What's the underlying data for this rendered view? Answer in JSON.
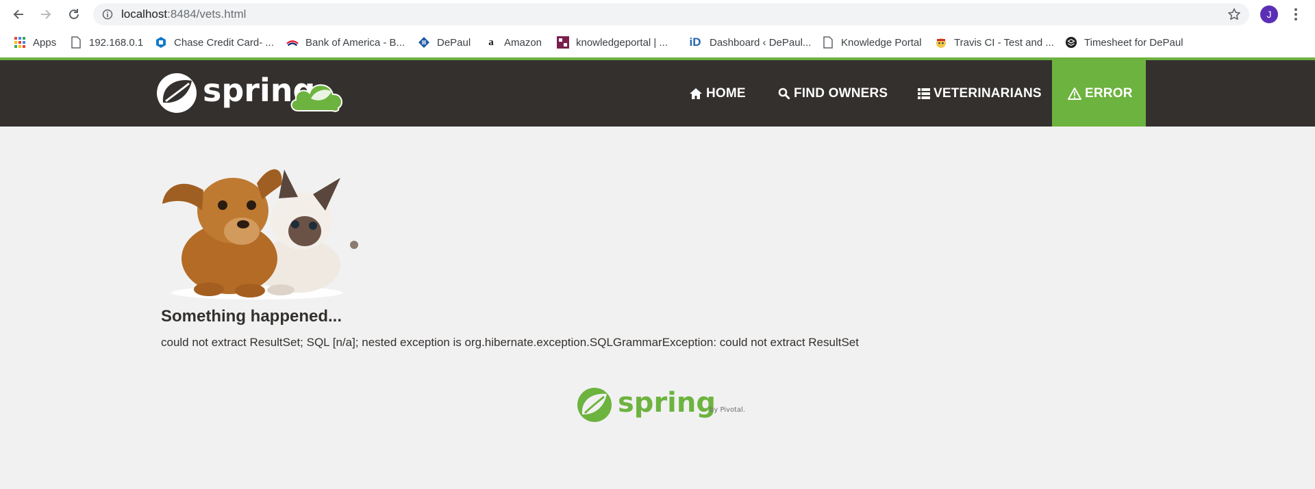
{
  "browser": {
    "url_host": "localhost",
    "url_rest": ":8484/vets.html",
    "profile_initial": "J",
    "bookmarks": [
      {
        "label": "Apps",
        "icon": "apps-grid-icon"
      },
      {
        "label": "192.168.0.1",
        "icon": "page-icon"
      },
      {
        "label": "Chase Credit Card- ...",
        "icon": "chase-icon"
      },
      {
        "label": "Bank of America - B...",
        "icon": "bofa-icon"
      },
      {
        "label": "DePaul",
        "icon": "depaul-icon"
      },
      {
        "label": "Amazon",
        "icon": "amazon-icon"
      },
      {
        "label": "knowledgeportal | ...",
        "icon": "knowledgeportal-icon"
      },
      {
        "label": "Dashboard ‹ DePaul...",
        "icon": "id-icon"
      },
      {
        "label": "Knowledge Portal",
        "icon": "page-icon"
      },
      {
        "label": "Travis CI - Test and ...",
        "icon": "travis-icon"
      },
      {
        "label": "Timesheet for DePaul",
        "icon": "timesheet-icon"
      }
    ]
  },
  "site": {
    "logo_text": "spring",
    "nav": [
      {
        "label": "HOME",
        "icon": "home-icon"
      },
      {
        "label": "FIND OWNERS",
        "icon": "search-icon"
      },
      {
        "label": "VETERINARIANS",
        "icon": "list-icon"
      },
      {
        "label": "ERROR",
        "icon": "warning-icon",
        "active": true
      }
    ],
    "accent_color": "#6db33f",
    "nav_bg_color": "#34302d"
  },
  "content": {
    "headline": "Something happened...",
    "message": "could not extract ResultSet; SQL [n/a]; nested exception is org.hibernate.exception.SQLGrammarException: could not extract ResultSet"
  },
  "footer": {
    "logo_text": "spring",
    "by_text": "by Pivotal."
  }
}
